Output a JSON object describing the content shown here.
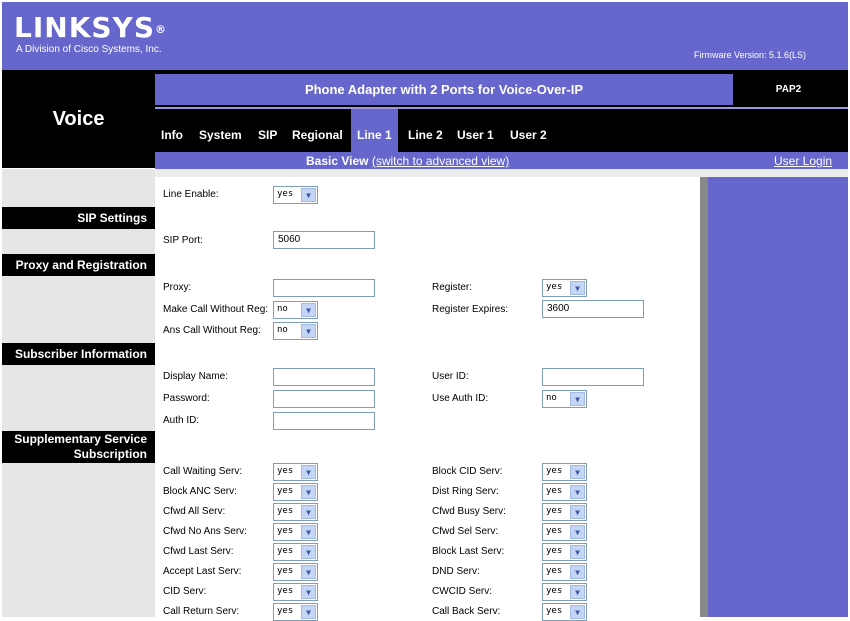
{
  "brand": {
    "logo": "LINKSYS",
    "reg": "®",
    "subtitle": "A Division of Cisco Systems, Inc."
  },
  "firmware": "Firmware Version: 5.1.6(LS)",
  "section_title": "Voice",
  "product_title": "Phone Adapter with 2 Ports for Voice-Over-IP",
  "model": "PAP2",
  "tabs": [
    "Info",
    "System",
    "SIP",
    "Regional",
    "Line 1",
    "Line 2",
    "User 1",
    "User 2"
  ],
  "active_tab": "Line 1",
  "view": {
    "label": "Basic View",
    "link": "(switch to advanced view)"
  },
  "user_login": "User Login",
  "sidebar": {
    "sip_settings": "SIP Settings",
    "proxy_registration": "Proxy and Registration",
    "subscriber_information": "Subscriber Information",
    "supplementary_line1": "Supplementary Service",
    "supplementary_line2": "Subscription"
  },
  "fields": {
    "line_enable": {
      "label": "Line Enable:",
      "value": "yes"
    },
    "sip_port": {
      "label": "SIP Port:",
      "value": "5060"
    },
    "proxy": {
      "label": "Proxy:",
      "value": ""
    },
    "register": {
      "label": "Register:",
      "value": "yes"
    },
    "make_call_without_reg": {
      "label": "Make Call Without Reg:",
      "value": "no"
    },
    "register_expires": {
      "label": "Register Expires:",
      "value": "3600"
    },
    "ans_call_without_reg": {
      "label": "Ans Call Without Reg:",
      "value": "no"
    },
    "display_name": {
      "label": "Display Name:",
      "value": ""
    },
    "user_id": {
      "label": "User ID:",
      "value": ""
    },
    "password": {
      "label": "Password:",
      "value": ""
    },
    "use_auth_id": {
      "label": "Use Auth ID:",
      "value": "no"
    },
    "auth_id": {
      "label": "Auth ID:",
      "value": ""
    }
  },
  "services_left": [
    {
      "label": "Call Waiting Serv:",
      "value": "yes"
    },
    {
      "label": "Block ANC Serv:",
      "value": "yes"
    },
    {
      "label": "Cfwd All Serv:",
      "value": "yes"
    },
    {
      "label": "Cfwd No Ans Serv:",
      "value": "yes"
    },
    {
      "label": "Cfwd Last Serv:",
      "value": "yes"
    },
    {
      "label": "Accept Last Serv:",
      "value": "yes"
    },
    {
      "label": "CID Serv:",
      "value": "yes"
    },
    {
      "label": "Call Return Serv:",
      "value": "yes"
    }
  ],
  "services_right": [
    {
      "label": "Block CID Serv:",
      "value": "yes"
    },
    {
      "label": "Dist Ring Serv:",
      "value": "yes"
    },
    {
      "label": "Cfwd Busy Serv:",
      "value": "yes"
    },
    {
      "label": "Cfwd Sel Serv:",
      "value": "yes"
    },
    {
      "label": "Block Last Serv:",
      "value": "yes"
    },
    {
      "label": "DND Serv:",
      "value": "yes"
    },
    {
      "label": "CWCID Serv:",
      "value": "yes"
    },
    {
      "label": "Call Back Serv:",
      "value": "yes"
    }
  ],
  "colors": {
    "purple": "#6666cc",
    "black": "#000000",
    "sidebar": "#e6e6e6"
  }
}
